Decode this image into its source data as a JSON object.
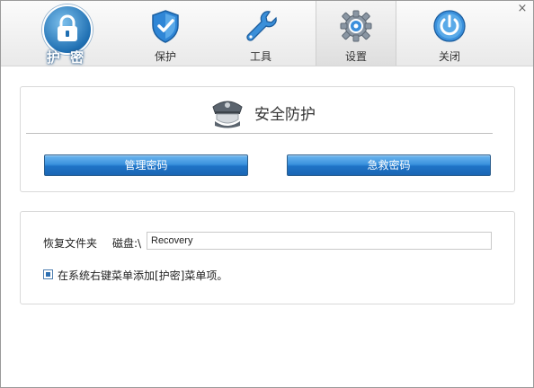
{
  "app": {
    "logo_text": "护 密"
  },
  "nav": {
    "tabs": [
      {
        "label": "保护",
        "icon": "shield-icon",
        "active": false
      },
      {
        "label": "工具",
        "icon": "wrench-icon",
        "active": false
      },
      {
        "label": "设置",
        "icon": "gear-icon",
        "active": true
      },
      {
        "label": "关闭",
        "icon": "power-icon",
        "active": false
      }
    ],
    "close_glyph": "×"
  },
  "security": {
    "title": "安全防护",
    "manage_password_label": "管理密码",
    "rescue_password_label": "急救密码"
  },
  "recovery": {
    "folder_label": "恢复文件夹",
    "disk_label": "磁盘:\\",
    "folder_value": "Recovery",
    "context_menu_checked": true,
    "context_menu_label": "在系统右键菜单添加[护密]菜单项。"
  },
  "colors": {
    "accent": "#2b7fd0",
    "button_border": "#2a5d8c"
  }
}
